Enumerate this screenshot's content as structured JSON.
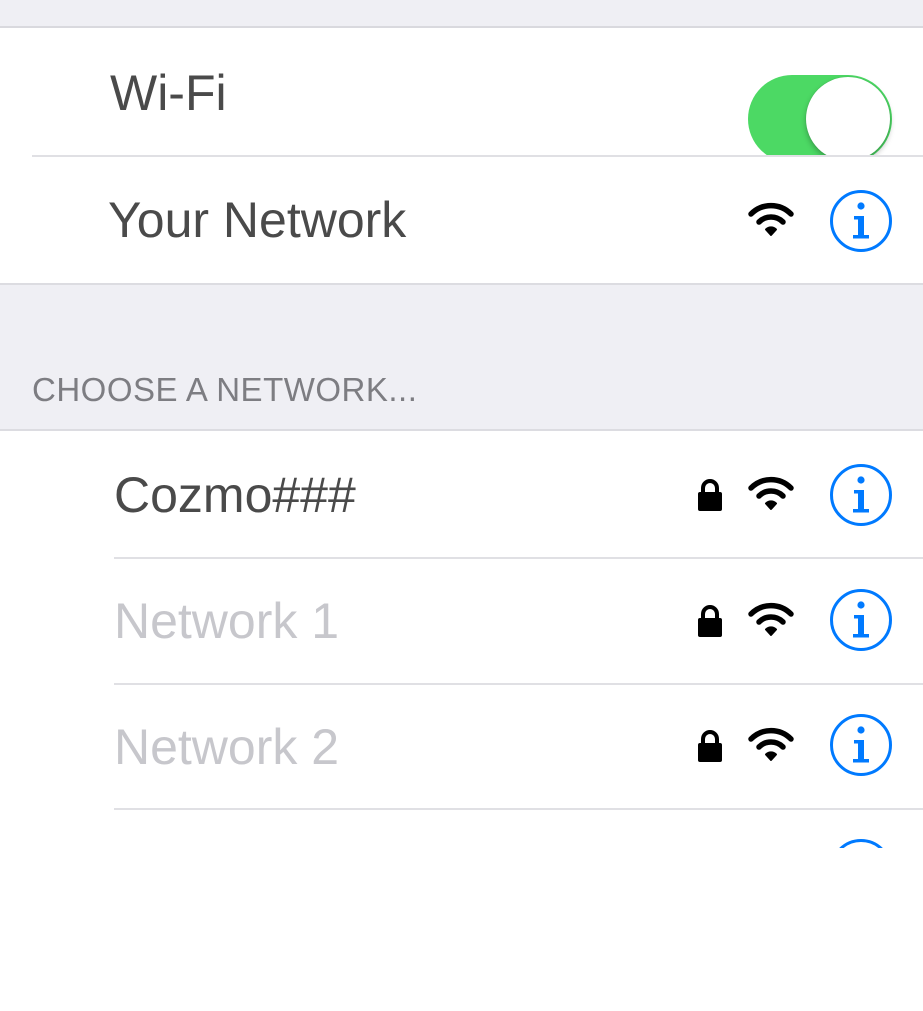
{
  "wifi": {
    "label": "Wi-Fi",
    "enabled": true,
    "toggle_color": "#4cd964"
  },
  "current_network": {
    "name": "Your Network",
    "icons": [
      "wifi-signal-icon",
      "info-icon"
    ]
  },
  "section": {
    "header": "CHOOSE A NETWORK..."
  },
  "networks": [
    {
      "name": "Cozmo###",
      "locked": true,
      "dimmed": false
    },
    {
      "name": "Network 1",
      "locked": true,
      "dimmed": true
    },
    {
      "name": "Network 2",
      "locked": true,
      "dimmed": true
    }
  ],
  "colors": {
    "accent": "#007aff",
    "group_background": "#efeff4",
    "separator": "#e0e0e4"
  }
}
